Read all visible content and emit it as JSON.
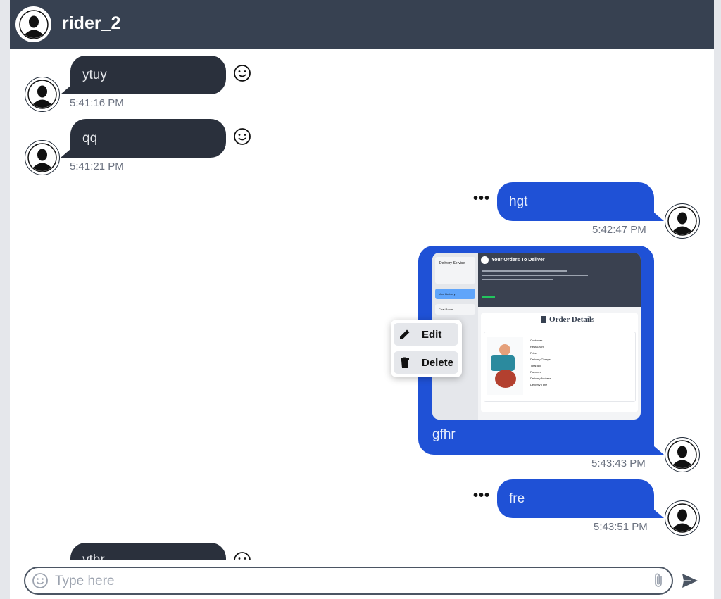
{
  "header": {
    "title": "rider_2",
    "avatar_icon": "user-avatar-icon"
  },
  "messages": [
    {
      "side": "left",
      "text": "ytuy",
      "time": "5:41:16 PM",
      "action_icon": "smiley-icon"
    },
    {
      "side": "left",
      "text": "qq",
      "time": "5:41:21 PM",
      "action_icon": "smiley-icon"
    },
    {
      "side": "right",
      "text": "hgt",
      "time": "5:42:47 PM",
      "action_icon": "more-dots-icon"
    },
    {
      "side": "right",
      "type": "image",
      "text": "gfhr",
      "time": "5:43:43 PM"
    },
    {
      "side": "right",
      "text": "fre",
      "time": "5:43:51 PM",
      "action_icon": "more-dots-icon"
    },
    {
      "side": "left",
      "text": "ytbr",
      "time": "",
      "action_icon": "smiley-icon"
    }
  ],
  "image_preview": {
    "sidebar_title": "Delivery Service",
    "header_title": "Your Orders To Deliver",
    "panel_title": "Order Details",
    "fields": [
      "Customer",
      "Restaurant",
      "Price",
      "Delivery Charge",
      "Total Bill",
      "Payment",
      "Delivery Address",
      "Delivery Time"
    ],
    "sidebar_items": [
      "Your Delivery",
      "Chat Room"
    ]
  },
  "context_menu": {
    "edit_label": "Edit",
    "delete_label": "Delete"
  },
  "composer": {
    "placeholder": "Type here"
  },
  "colors": {
    "header_bg": "#374151",
    "incoming_bubble": "#2a303c",
    "outgoing_bubble": "#1f51d6"
  }
}
